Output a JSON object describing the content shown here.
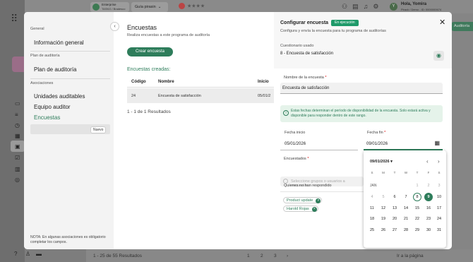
{
  "topbar": {
    "enterprise_name": "Enterprise",
    "enterprise_sub": "TASKO / Bradesco",
    "guide_label": "Guía pirasin",
    "user_name": "Hola, Yomira",
    "user_sub": "Pirack / Demo - ID: 0000000674",
    "user_initial": "Y"
  },
  "nav": {
    "sections": [
      "General",
      "Plan de auditoría",
      "Asociaciones"
    ],
    "items": [
      "Información general",
      "Plan de auditoría",
      "Unidades auditables",
      "Equipo auditor",
      "Encuestas"
    ],
    "new_badge": "Nuevo",
    "note": "NOTA: En algunas asociaciones es obligatorio completar los campos."
  },
  "content": {
    "title": "Encuestas",
    "subtitle": "Realiza encuestas a este programa de auditoría",
    "create_button": "Crear encuesta",
    "created_label": "Encuestas creadas:",
    "columns": [
      "Código",
      "Nombre",
      "Inicio"
    ],
    "rows": [
      [
        "24",
        "Encuesta de satisfacción",
        "05/01/2"
      ]
    ],
    "range": "1 - 1 de 1 Resultados"
  },
  "background_footer": {
    "results": "1 - 25 de 55 Resultados",
    "pages": [
      "1",
      "2",
      "3"
    ],
    "goto": "Ir a la página",
    "right_button": "Auditoría"
  },
  "drawer": {
    "title": "Configurar encuesta",
    "status": "En ejecución",
    "subtitle": "Configura y envía la encuesta para tu programa de auditorías",
    "questionnaire_label": "Cuestionario usado",
    "questionnaire_value": "8 - Encuesta de satisfacción",
    "survey_name_label": "Nombre de la encuesta",
    "survey_name_value": "Encuesta de satisfacción",
    "info_text": "Estas fechas determinan el período de disponibilidad de la encuesta. Solo estará activa y disponible para responder dentro de este rango.",
    "start_label": "Fecha inicio",
    "start_value": "05/01/2026",
    "end_label": "Fecha fin",
    "end_value": "09/01/2026",
    "surveyed_label": "Encuestados",
    "groups_placeholder": "Seleccione grupos o usuarios a encuestar",
    "pending_label": "Quienes no han respondido",
    "chips": [
      "Product update",
      "Harold Rojas"
    ]
  },
  "calendar": {
    "month_label": "09/01/2026",
    "month_short": "JAN",
    "weekdays": [
      "S",
      "M",
      "T",
      "W",
      "T",
      "F",
      "S"
    ],
    "weeks": [
      [
        "",
        "",
        "",
        "",
        "1",
        "2",
        "3"
      ],
      [
        "4",
        "5",
        "6",
        "7",
        "8",
        "9",
        "10"
      ],
      [
        "11",
        "12",
        "13",
        "14",
        "15",
        "16",
        "17"
      ],
      [
        "18",
        "19",
        "20",
        "21",
        "22",
        "23",
        "24"
      ],
      [
        "25",
        "26",
        "27",
        "28",
        "29",
        "30",
        "31"
      ]
    ],
    "today": "8",
    "selected": "9",
    "dim_days": [
      "1",
      "2",
      "3",
      "4",
      "5"
    ]
  },
  "colors": {
    "accent": "#2e7d5b",
    "status": "#1f9a6a"
  }
}
